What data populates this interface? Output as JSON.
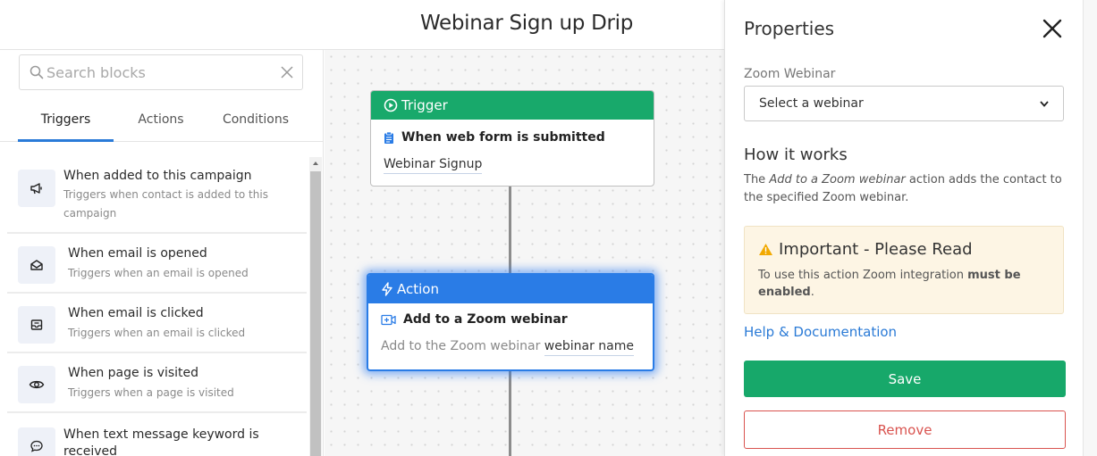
{
  "header": {
    "title": "Webinar Sign up Drip"
  },
  "search": {
    "placeholder": "Search blocks",
    "value": ""
  },
  "tabs": [
    {
      "label": "Triggers",
      "active": true
    },
    {
      "label": "Actions",
      "active": false
    },
    {
      "label": "Conditions",
      "active": false
    }
  ],
  "triggers": [
    {
      "title": "When added to this campaign",
      "desc": "Triggers when contact is added to this campaign",
      "icon": "megaphone-icon"
    },
    {
      "title": "When email is opened",
      "desc": "Triggers when an email is opened",
      "icon": "envelope-open-icon"
    },
    {
      "title": "When email is clicked",
      "desc": "Triggers when an email is clicked",
      "icon": "envelope-click-icon"
    },
    {
      "title": "When page is visited",
      "desc": "Triggers when a page is visited",
      "icon": "eye-icon"
    },
    {
      "title": "When text message keyword is received",
      "desc": "",
      "icon": "chat-icon"
    }
  ],
  "canvas": {
    "trigger_node": {
      "header": "Trigger",
      "title": "When web form is submitted",
      "value": "Webinar Signup"
    },
    "action_node": {
      "header": "Action",
      "title": "Add to a Zoom webinar",
      "prefix": "Add to the Zoom webinar",
      "value": "webinar name"
    }
  },
  "properties": {
    "title": "Properties",
    "field_label": "Zoom Webinar",
    "select_value": "Select a webinar",
    "how_title": "How it works",
    "how_text_pre": "The ",
    "how_text_em": "Add to a Zoom webinar",
    "how_text_post": " action adds the contact to the specified Zoom webinar.",
    "warning_title": "Important - Please Read",
    "warning_text_pre": "To use this action Zoom integration ",
    "warning_text_bold": "must be enabled",
    "warning_text_post": ".",
    "help_link": "Help & Documentation",
    "save_label": "Save",
    "remove_label": "Remove"
  },
  "colors": {
    "trigger_green": "#18a96b",
    "action_blue": "#2a7ce6",
    "link_blue": "#2a7ad6",
    "remove_red": "#d9534f",
    "warning_bg": "#fdf5e4"
  }
}
